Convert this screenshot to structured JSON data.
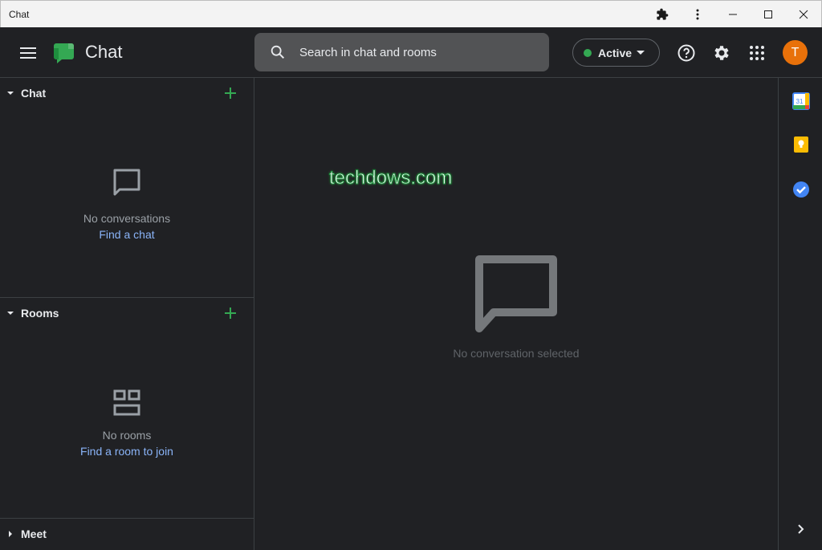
{
  "window": {
    "title": "Chat"
  },
  "header": {
    "app_name": "Chat",
    "search_placeholder": "Search in chat and rooms",
    "status_label": "Active",
    "avatar_initial": "T"
  },
  "sidebar": {
    "chat": {
      "title": "Chat",
      "empty_title": "No conversations",
      "empty_link": "Find a chat"
    },
    "rooms": {
      "title": "Rooms",
      "empty_title": "No rooms",
      "empty_link": "Find a room to join"
    },
    "meet": {
      "title": "Meet"
    }
  },
  "main": {
    "watermark": "techdows.com",
    "empty_text": "No conversation selected"
  },
  "side_apps": [
    "calendar-icon",
    "keep-icon",
    "tasks-icon"
  ],
  "colors": {
    "background": "#202124",
    "accent_green": "#34a853",
    "link_blue": "#8ab4f8",
    "avatar_orange": "#e8710a"
  }
}
